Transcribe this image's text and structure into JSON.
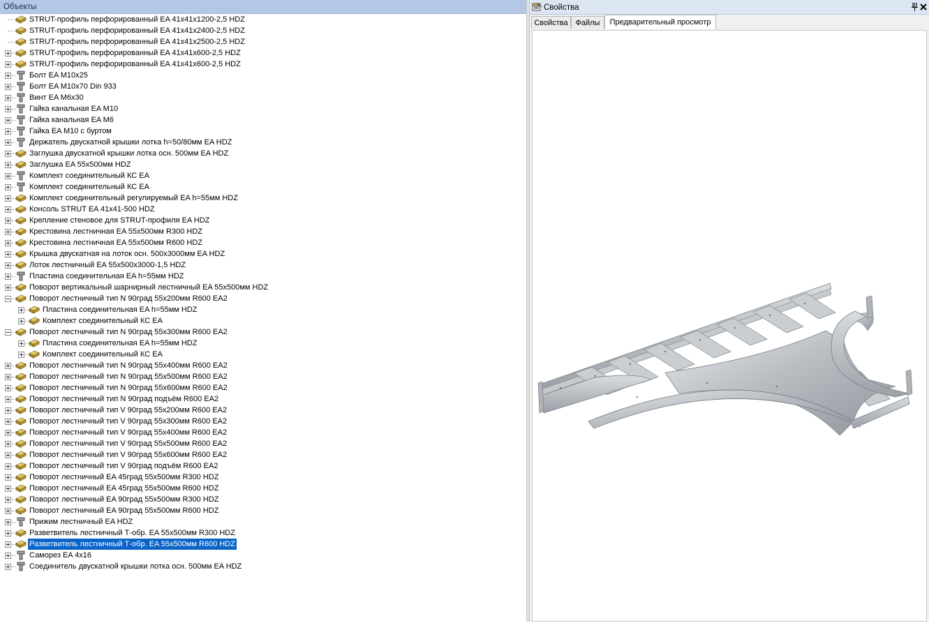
{
  "objects_panel": {
    "title": "Объекты"
  },
  "properties_panel": {
    "title": "Свойства",
    "pin_icon": "pin-icon",
    "close_icon": "close-icon",
    "tabs": [
      {
        "label": "Свойства",
        "active": false
      },
      {
        "label": "Файлы",
        "active": false
      },
      {
        "label": "Предварительный просмотр",
        "active": true
      }
    ]
  },
  "tree": [
    {
      "label": "STRUT-профиль перфорированный EA 41x41x1200-2,5 HDZ",
      "icon": "profile-icon",
      "level": 0,
      "expander": "none"
    },
    {
      "label": "STRUT-профиль перфорированный EA 41x41x2400-2,5 HDZ",
      "icon": "profile-icon",
      "level": 0,
      "expander": "none"
    },
    {
      "label": "STRUT-профиль перфорированный EA 41x41x2500-2,5 HDZ",
      "icon": "profile-icon",
      "level": 0,
      "expander": "none"
    },
    {
      "label": "STRUT-профиль перфорированный EA 41x41x600-2,5 HDZ",
      "icon": "profile-icon",
      "level": 0,
      "expander": "plus"
    },
    {
      "label": "STRUT-профиль перфорированный EA 41x41x600-2,5 HDZ",
      "icon": "profile-icon",
      "level": 0,
      "expander": "plus"
    },
    {
      "label": "Болт EA M10x25",
      "icon": "bolt-icon",
      "level": 0,
      "expander": "plus"
    },
    {
      "label": "Болт EA M10x70 Din  933",
      "icon": "bolt-icon",
      "level": 0,
      "expander": "plus"
    },
    {
      "label": "Винт EA M6x30",
      "icon": "bolt-icon",
      "level": 0,
      "expander": "plus"
    },
    {
      "label": "Гайка канальная EA M10",
      "icon": "bolt-icon",
      "level": 0,
      "expander": "plus"
    },
    {
      "label": "Гайка канальная EA M6",
      "icon": "bolt-icon",
      "level": 0,
      "expander": "plus"
    },
    {
      "label": "Гайка EA M10 с буртом",
      "icon": "bolt-icon",
      "level": 0,
      "expander": "plus"
    },
    {
      "label": "Держатель двускатной крышки лотка h=50/80мм EA HDZ",
      "icon": "bolt-icon",
      "level": 0,
      "expander": "plus"
    },
    {
      "label": "Заглушка двускатной крышки лотка осн. 500мм EA HDZ",
      "icon": "profile-icon",
      "level": 0,
      "expander": "plus"
    },
    {
      "label": "Заглушка EA 55x500мм HDZ",
      "icon": "profile-icon",
      "level": 0,
      "expander": "plus"
    },
    {
      "label": "Комплект соединительный КС EA",
      "icon": "bolt-icon",
      "level": 0,
      "expander": "plus"
    },
    {
      "label": "Комплект соединительный КС EA",
      "icon": "bolt-icon",
      "level": 0,
      "expander": "plus"
    },
    {
      "label": "Комплект соединительный регулируемый EA h=55мм HDZ",
      "icon": "profile-icon",
      "level": 0,
      "expander": "plus"
    },
    {
      "label": "Консоль STRUT EA 41x41-500 HDZ",
      "icon": "profile-icon",
      "level": 0,
      "expander": "plus"
    },
    {
      "label": "Крепление стеновое для STRUT-профиля EA HDZ",
      "icon": "profile-icon",
      "level": 0,
      "expander": "plus"
    },
    {
      "label": "Крестовина лестничная EA 55x500мм R300 HDZ",
      "icon": "profile-icon",
      "level": 0,
      "expander": "plus"
    },
    {
      "label": "Крестовина лестничная EA 55x500мм R600 HDZ",
      "icon": "profile-icon",
      "level": 0,
      "expander": "plus"
    },
    {
      "label": "Крышка двускатная на лоток осн. 500x3000мм EA HDZ",
      "icon": "profile-icon",
      "level": 0,
      "expander": "plus"
    },
    {
      "label": "Лоток лестничный EA 55x500x3000-1,5 HDZ",
      "icon": "profile-icon",
      "level": 0,
      "expander": "plus"
    },
    {
      "label": "Пластина соединительная EA h=55мм HDZ",
      "icon": "bolt-icon",
      "level": 0,
      "expander": "plus"
    },
    {
      "label": "Поворот вертикальный  шарнирный лестничный EA 55x500мм HDZ",
      "icon": "profile-icon",
      "level": 0,
      "expander": "plus"
    },
    {
      "label": "Поворот лестничный тип N 90град  55x200мм R600 EA2",
      "icon": "profile-icon",
      "level": 0,
      "expander": "minus"
    },
    {
      "label": "Пластина соединительная EA h=55мм HDZ",
      "icon": "profile-icon",
      "level": 1,
      "expander": "plus"
    },
    {
      "label": "Комплект соединительный КС EA",
      "icon": "profile-icon",
      "level": 1,
      "expander": "plus"
    },
    {
      "label": "Поворот лестничный тип N 90град  55x300мм R600 EA2",
      "icon": "profile-icon",
      "level": 0,
      "expander": "minus"
    },
    {
      "label": "Пластина соединительная EA h=55мм HDZ",
      "icon": "profile-icon",
      "level": 1,
      "expander": "plus"
    },
    {
      "label": "Комплект соединительный КС EA",
      "icon": "profile-icon",
      "level": 1,
      "expander": "plus"
    },
    {
      "label": "Поворот лестничный тип N 90град  55x400мм R600 EA2",
      "icon": "profile-icon",
      "level": 0,
      "expander": "plus"
    },
    {
      "label": "Поворот лестничный тип N 90град  55x500мм R600 EA2",
      "icon": "profile-icon",
      "level": 0,
      "expander": "plus"
    },
    {
      "label": "Поворот лестничный тип N 90град  55x600мм R600 EA2",
      "icon": "profile-icon",
      "level": 0,
      "expander": "plus"
    },
    {
      "label": "Поворот лестничный тип N 90град  подъём R600 EA2",
      "icon": "profile-icon",
      "level": 0,
      "expander": "plus"
    },
    {
      "label": "Поворот лестничный тип V 90град  55x200мм R600 EA2",
      "icon": "profile-icon",
      "level": 0,
      "expander": "plus"
    },
    {
      "label": "Поворот лестничный тип V 90град  55x300мм R600 EA2",
      "icon": "profile-icon",
      "level": 0,
      "expander": "plus"
    },
    {
      "label": "Поворот лестничный тип V 90град  55x400мм R600 EA2",
      "icon": "profile-icon",
      "level": 0,
      "expander": "plus"
    },
    {
      "label": "Поворот лестничный тип V 90град  55x500мм R600 EA2",
      "icon": "profile-icon",
      "level": 0,
      "expander": "plus"
    },
    {
      "label": "Поворот лестничный тип V 90град  55x600мм R600 EA2",
      "icon": "profile-icon",
      "level": 0,
      "expander": "plus"
    },
    {
      "label": "Поворот лестничный тип V 90град  подъём R600 EA2",
      "icon": "profile-icon",
      "level": 0,
      "expander": "plus"
    },
    {
      "label": "Поворот лестничный EA 45град 55x500мм R300 HDZ",
      "icon": "profile-icon",
      "level": 0,
      "expander": "plus"
    },
    {
      "label": "Поворот лестничный EA 45град 55x500мм R600 HDZ",
      "icon": "profile-icon",
      "level": 0,
      "expander": "plus"
    },
    {
      "label": "Поворот лестничный EA 90град 55x500мм R300 HDZ",
      "icon": "profile-icon",
      "level": 0,
      "expander": "plus"
    },
    {
      "label": "Поворот лестничный EA 90град 55x500мм R600 HDZ",
      "icon": "profile-icon",
      "level": 0,
      "expander": "plus"
    },
    {
      "label": "Прижим лестничный EA HDZ",
      "icon": "bolt-icon",
      "level": 0,
      "expander": "plus"
    },
    {
      "label": "Разветвитель лестничный Т-обр. EA 55x500мм R300 HDZ",
      "icon": "profile-icon",
      "level": 0,
      "expander": "plus"
    },
    {
      "label": "Разветвитель лестничный Т-обр. EA 55x500мм R600 HDZ",
      "icon": "profile-icon",
      "level": 0,
      "expander": "plus",
      "selected": true
    },
    {
      "label": "Саморез EA 4x16",
      "icon": "bolt-icon",
      "level": 0,
      "expander": "plus"
    },
    {
      "label": "Соединитель двускатной крышки лотка осн. 500мм EA HDZ",
      "icon": "bolt-icon",
      "level": 0,
      "expander": "plus"
    }
  ],
  "preview_image": "t-branch-cable-ladder-image",
  "colors": {
    "selection": "#0a64c8",
    "panel_title": "#b4c8e6"
  }
}
